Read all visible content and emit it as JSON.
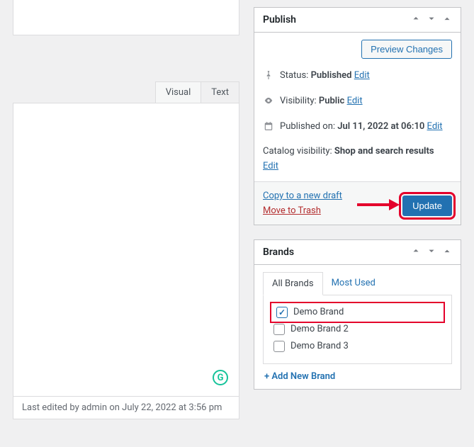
{
  "editor": {
    "tabs": {
      "visual": "Visual",
      "text": "Text"
    },
    "last_edited": "Last edited by admin on July 22, 2022 at 3:56 pm"
  },
  "publish": {
    "title": "Publish",
    "preview_button": "Preview Changes",
    "status_label": "Status:",
    "status_value": "Published",
    "edit": "Edit",
    "visibility_label": "Visibility:",
    "visibility_value": "Public",
    "published_label": "Published on:",
    "published_value": "Jul 11, 2022 at 06:10",
    "catalog_label": "Catalog visibility:",
    "catalog_value": "Shop and search results",
    "copy_draft": "Copy to a new draft",
    "move_trash": "Move to Trash",
    "update": "Update"
  },
  "brands": {
    "title": "Brands",
    "tab_all": "All Brands",
    "tab_most": "Most Used",
    "items": [
      {
        "label": "Demo Brand",
        "checked": true,
        "highlight": true
      },
      {
        "label": "Demo Brand 2",
        "checked": false,
        "highlight": false
      },
      {
        "label": "Demo Brand 3",
        "checked": false,
        "highlight": false
      }
    ],
    "add_new": "+ Add New Brand"
  }
}
